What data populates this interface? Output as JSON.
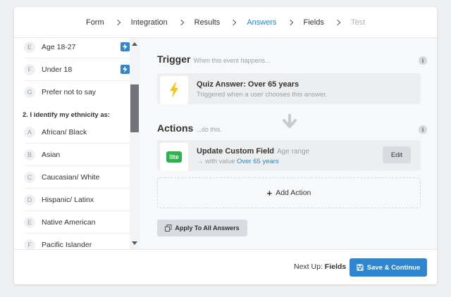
{
  "breadcrumb": [
    {
      "label": "Form",
      "state": "normal"
    },
    {
      "label": "Integration",
      "state": "normal"
    },
    {
      "label": "Results",
      "state": "normal"
    },
    {
      "label": "Answers",
      "state": "active"
    },
    {
      "label": "Fields",
      "state": "normal"
    },
    {
      "label": "Test",
      "state": "muted"
    }
  ],
  "answers_top": [
    {
      "letter": "E",
      "label": "Age 18-27",
      "linked": true
    },
    {
      "letter": "F",
      "label": "Under 18",
      "linked": true
    },
    {
      "letter": "G",
      "label": "Prefer not to say",
      "linked": false
    }
  ],
  "question": "2. I identify my ethnicity as:",
  "answers_bottom": [
    {
      "letter": "A",
      "label": "African/ Black"
    },
    {
      "letter": "B",
      "label": "Asian"
    },
    {
      "letter": "C",
      "label": "Caucasian/ White"
    },
    {
      "letter": "D",
      "label": "Hispanic/ Latinx"
    },
    {
      "letter": "E",
      "label": "Native American"
    },
    {
      "letter": "F",
      "label": "Pacific Islander"
    }
  ],
  "trigger": {
    "title": "Trigger",
    "subtitle": "When this event happens...",
    "event_title": "Quiz Answer: Over 65 years",
    "event_desc": "Triggered when a user chooses this answer."
  },
  "actions": {
    "title": "Actions",
    "subtitle": "...do this.",
    "action_title": "Update Custom Field",
    "action_hint": "Age range",
    "action_desc_prefix": "with value",
    "action_value": "Over 65 years",
    "logo_text": "lite",
    "edit_label": "Edit",
    "add_label": "Add Action"
  },
  "apply_label": "Apply To All Answers",
  "footer": {
    "next_prefix": "Next Up:",
    "next_value": "Fields",
    "save_label": "Save & Continue"
  },
  "colors": {
    "accent": "#2d86cf",
    "logo_green": "#2bb24c",
    "bolt_yellow": "#f5c518"
  }
}
